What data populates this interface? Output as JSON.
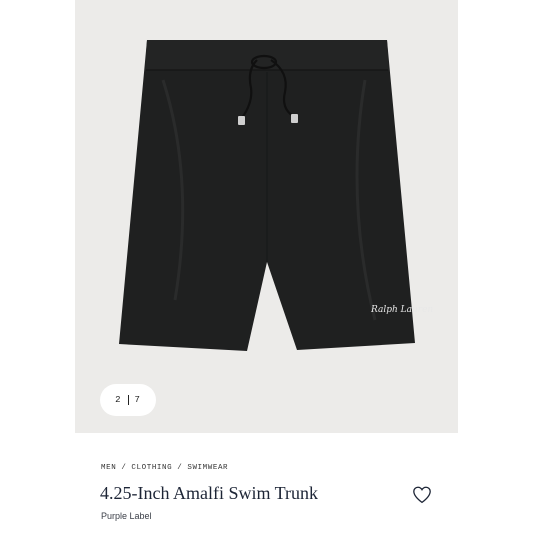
{
  "gallery": {
    "current": "2",
    "total": "7"
  },
  "breadcrumb": [
    "MEN",
    "CLOTHING",
    "SWIMWEAR"
  ],
  "product": {
    "title": "4.25-Inch Amalfi Swim Trunk",
    "subtitle": "Purple Label",
    "embroidery": "Ralph Lauren"
  },
  "icons": {
    "wishlist": "heart-icon"
  },
  "colors": {
    "background_panel": "#ecebe9",
    "shorts": "#1e1f1f",
    "title_text": "#1d2536"
  }
}
